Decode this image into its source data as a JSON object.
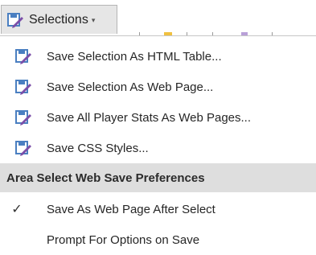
{
  "toolbar": {
    "selections_label": "Selections",
    "caret": "▾"
  },
  "menu": {
    "items": [
      {
        "label": "Save Selection As HTML Table...",
        "icon": "save-pencil-icon"
      },
      {
        "label": "Save Selection As Web Page...",
        "icon": "save-pencil-icon"
      },
      {
        "label": "Save All Player Stats As Web Pages...",
        "icon": "save-pencil-icon"
      },
      {
        "label": "Save CSS Styles...",
        "icon": "save-pencil-icon"
      }
    ],
    "section_header": "Area Select Web Save Preferences",
    "preferences": [
      {
        "label": "Save As Web Page After Select",
        "checked": true,
        "check_glyph": "✓"
      },
      {
        "label": "Prompt For Options on Save",
        "checked": false
      }
    ]
  },
  "colors": {
    "icon_blue": "#4a7fc1",
    "icon_purple": "#7b4ea8",
    "header_bg": "#dedede"
  }
}
